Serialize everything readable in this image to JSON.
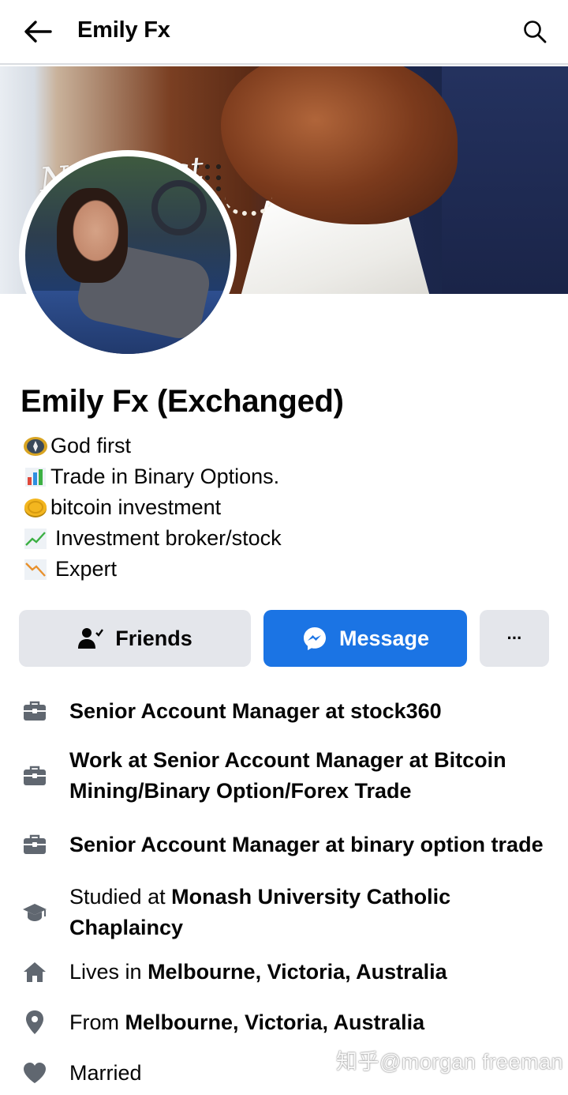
{
  "topbar": {
    "title": "Emily Fx"
  },
  "cover": {
    "overlay_text": "New Post"
  },
  "profile": {
    "name": "Emily Fx (Exchanged)",
    "bio": [
      {
        "icon": "compass-icon",
        "text": "God first"
      },
      {
        "icon": "bar-chart-icon",
        "text": "Trade in Binary Options."
      },
      {
        "icon": "coin-icon",
        "text": "bitcoin investment"
      },
      {
        "icon": "chart-increasing-icon",
        "text": "Investment broker/stock"
      },
      {
        "icon": "chart-decreasing-icon",
        "text": "Expert"
      }
    ]
  },
  "actions": {
    "friends_label": "Friends",
    "message_label": "Message",
    "more_label": "···"
  },
  "details": {
    "work1": {
      "bold": "Senior Account Manager at stock360"
    },
    "work2": {
      "bold": "Work at Senior Account Manager at Bitcoin Mining/Binary Option/Forex Trade"
    },
    "work3": {
      "bold": "Senior Account Manager at binary option trade"
    },
    "education": {
      "prefix": "Studied at ",
      "bold": "Monash University Catholic Chaplaincy"
    },
    "lives": {
      "prefix": "Lives in ",
      "bold": "Melbourne, Victoria, Australia"
    },
    "from": {
      "prefix": "From ",
      "bold": "Melbourne, Victoria, Australia"
    },
    "relationship": {
      "text": "Married"
    }
  },
  "watermark": "知乎@morgan freeman",
  "colors": {
    "accent": "#1b74e4",
    "button_gray": "#e4e6eb",
    "icon_gray": "#606770"
  }
}
